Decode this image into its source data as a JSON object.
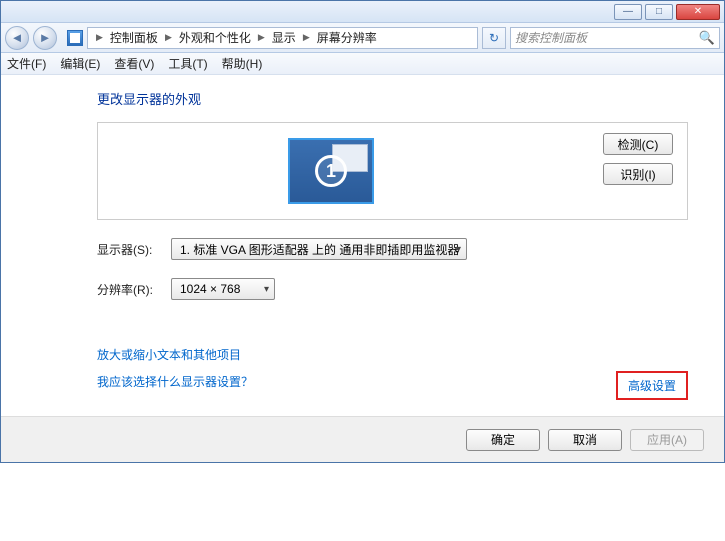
{
  "window_controls": {
    "minimize": "—",
    "maximize": "□",
    "close": "✕"
  },
  "breadcrumb": {
    "items": [
      "控制面板",
      "外观和个性化",
      "显示",
      "屏幕分辨率"
    ]
  },
  "search": {
    "placeholder": "搜索控制面板"
  },
  "menu": {
    "file": "文件(F)",
    "edit": "编辑(E)",
    "view": "查看(V)",
    "tools": "工具(T)",
    "help": "帮助(H)"
  },
  "heading": "更改显示器的外观",
  "monitor_number": "1",
  "buttons": {
    "detect": "检测(C)",
    "identify": "识别(I)"
  },
  "labels": {
    "display": "显示器(S):",
    "resolution": "分辨率(R):"
  },
  "dropdowns": {
    "display_value": "1. 标准 VGA 图形适配器 上的 通用非即插即用监视器",
    "resolution_value": "1024 × 768"
  },
  "links": {
    "advanced": "高级设置",
    "text_size": "放大或缩小文本和其他项目",
    "which_disp": "我应该选择什么显示器设置？"
  },
  "footer": {
    "ok": "确定",
    "cancel": "取消",
    "apply": "应用(A)"
  }
}
